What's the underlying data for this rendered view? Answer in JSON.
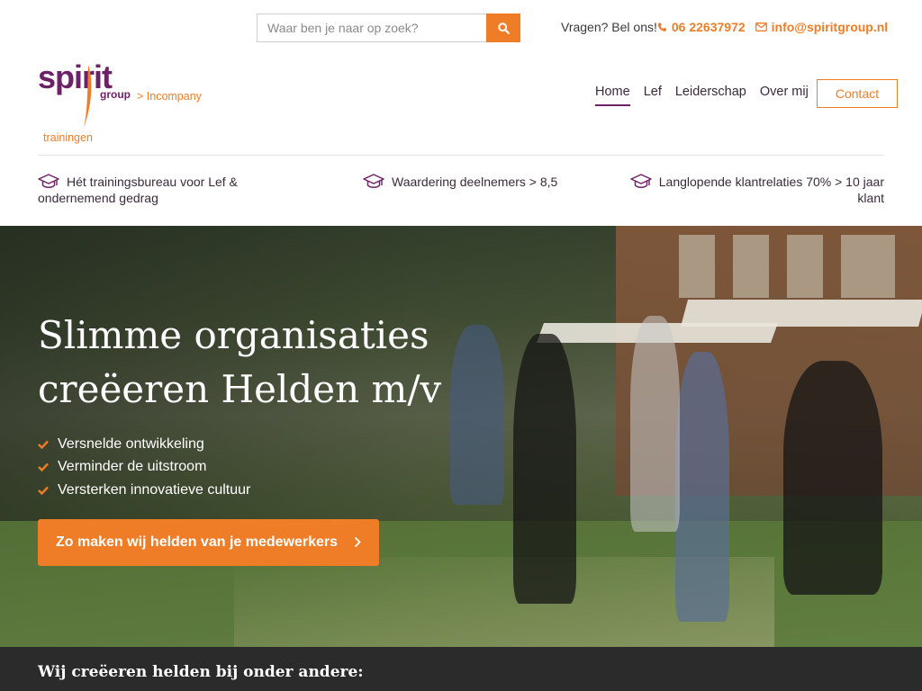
{
  "search": {
    "placeholder": "Waar ben je naar op zoek?"
  },
  "topbar": {
    "question": "Vragen? Bel ons!",
    "phone": "06 22637972",
    "email": "info@spiritgroup.nl"
  },
  "logo": {
    "word": "spirit",
    "group": "group",
    "sub": "trainingen",
    "incompany": "> Incompany"
  },
  "nav": {
    "items": [
      {
        "label": "Home",
        "active": true
      },
      {
        "label": "Lef",
        "active": false
      },
      {
        "label": "Leiderschap",
        "active": false
      },
      {
        "label": "Over mij",
        "active": false
      }
    ],
    "contact": "Contact"
  },
  "usps": [
    {
      "text": "Hét trainingsbureau voor Lef & ondernemend gedrag",
      "icon": "graduation-cap-icon"
    },
    {
      "text": "Waardering deelnemers > 8,5",
      "icon": "graduation-cap-icon"
    },
    {
      "text": "Langlopende klantrelaties 70% > 10 jaar klant",
      "icon": "graduation-cap-icon"
    }
  ],
  "hero": {
    "title_line1": "Slimme organisaties",
    "title_line2": "creëeren Helden m/v",
    "bullets": [
      "Versnelde ontwikkeling",
      "Verminder de uitstroom",
      "Versterken innovatieve cultuur"
    ],
    "cta": "Zo maken wij helden van je medewerkers"
  },
  "strip": {
    "text": "Wij creëeren helden bij onder andere:"
  },
  "colors": {
    "accent": "#ef7d28",
    "brand": "#6b2266",
    "dark": "#2b2b2b"
  }
}
